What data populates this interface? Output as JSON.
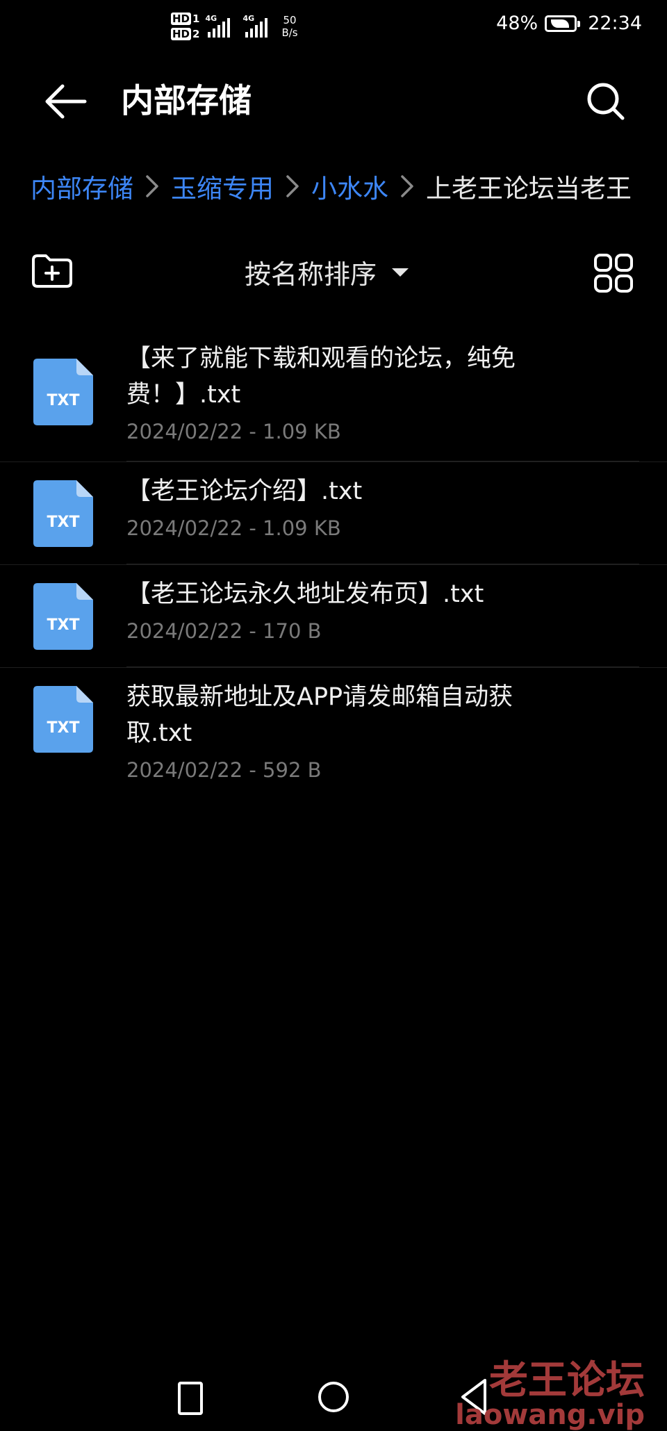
{
  "status_bar": {
    "hd_1": "HD",
    "hd_2": "HD",
    "sim1_label": "4G",
    "sim2_label": "4G",
    "net_speed_value": "50",
    "net_speed_unit": "B/s",
    "battery_percent": "48%",
    "time": "22:34"
  },
  "app_bar": {
    "title": "内部存储",
    "back_icon": "arrow-left-icon",
    "search_icon": "search-icon"
  },
  "breadcrumb": {
    "items": [
      "内部存储",
      "玉缩专用",
      "小水水",
      "上老王论坛当老王"
    ]
  },
  "toolbar": {
    "new_folder_icon": "folder-plus-icon",
    "sort_label": "按名称排序",
    "view_toggle_icon": "grid-view-icon"
  },
  "files": [
    {
      "icon_label": "TXT",
      "name": "【来了就能下载和观看的论坛，纯免费！】.txt",
      "meta": "2024/02/22 - 1.09 KB"
    },
    {
      "icon_label": "TXT",
      "name": "【老王论坛介绍】.txt",
      "meta": "2024/02/22 - 1.09 KB"
    },
    {
      "icon_label": "TXT",
      "name": "【老王论坛永久地址发布页】.txt",
      "meta": "2024/02/22 - 170 B"
    },
    {
      "icon_label": "TXT",
      "name": "获取最新地址及APP请发邮箱自动获取.txt",
      "meta": "2024/02/22 - 592 B"
    }
  ],
  "watermark": {
    "text_cn": "老王论坛",
    "text_url": "laowang.vip"
  },
  "colors": {
    "background": "#000000",
    "accent": "#3d86f6",
    "file_icon": "#5aa2ec",
    "meta_text": "#7a7a7a",
    "watermark": "#a33a3a"
  }
}
